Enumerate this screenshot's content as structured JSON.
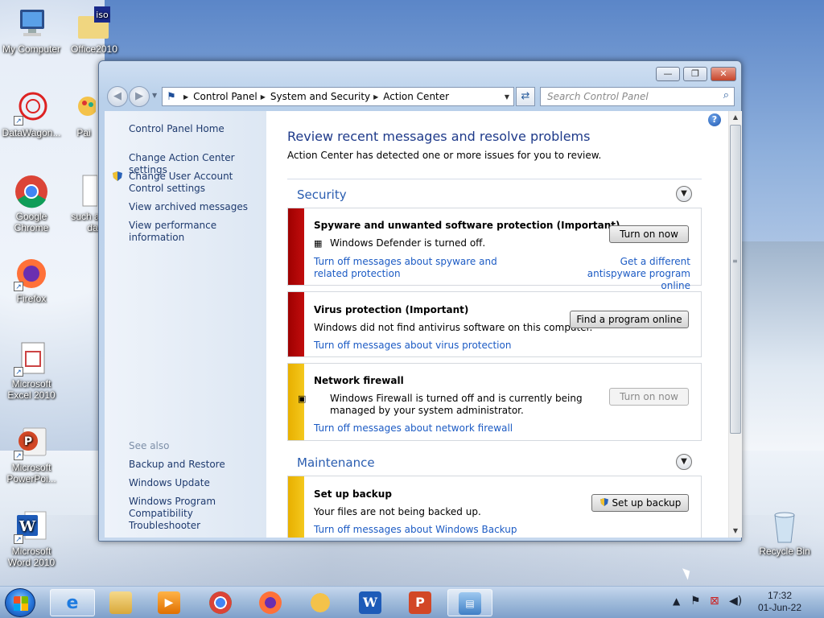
{
  "desktop": {
    "icons": [
      {
        "label": "My Computer",
        "icon": "computer-icon"
      },
      {
        "label": "Office2010",
        "icon": "iso-folder-icon",
        "badge": "iso"
      },
      {
        "label": "DataWagon...",
        "icon": "datawagon-icon"
      },
      {
        "label": "Pai",
        "icon": "paint-icon"
      },
      {
        "label": "Google Chrome",
        "icon": "chrome-icon"
      },
      {
        "label": "such a",
        "label2": "da",
        "icon": "document-icon"
      },
      {
        "label": "Firefox",
        "icon": "firefox-icon"
      },
      {
        "label": "Microsoft Excel 2010",
        "icon": "excel-icon"
      },
      {
        "label": "Microsoft PowerPoi...",
        "icon": "powerpoint-icon"
      },
      {
        "label": "Microsoft Word 2010",
        "icon": "word-icon"
      },
      {
        "label": "Recycle Bin",
        "icon": "recycle-bin-icon"
      }
    ]
  },
  "window": {
    "controls": {
      "minimize": "—",
      "maximize": "❐",
      "close": "✕"
    },
    "address": {
      "crumbs": [
        "Control Panel",
        "System and Security",
        "Action Center"
      ]
    },
    "search": {
      "placeholder": "Search Control Panel"
    },
    "sidebar": {
      "home": "Control Panel Home",
      "links": [
        "Change Action Center settings",
        "Change User Account Control settings",
        "View archived messages",
        "View performance information"
      ],
      "see_also_title": "See also",
      "see_also": [
        "Backup and Restore",
        "Windows Update",
        "Windows Program Compatibility Troubleshooter"
      ]
    },
    "main": {
      "heading": "Review recent messages and resolve problems",
      "subtitle": "Action Center has detected one or more issues for you to review.",
      "sections": {
        "security": "Security",
        "maintenance": "Maintenance"
      },
      "cards": {
        "spyware": {
          "title": "Spyware and unwanted software protection  (Important)",
          "text": "Windows Defender is turned off.",
          "link_left": "Turn off messages about spyware and related protection",
          "link_right": "Get a different antispyware program online",
          "button": "Turn on now",
          "severity_color": "#b30000"
        },
        "virus": {
          "title": "Virus protection  (Important)",
          "text": "Windows did not find antivirus software on this computer.",
          "link": "Turn off messages about virus protection",
          "button": "Find a program online",
          "severity_color": "#b30000"
        },
        "firewall": {
          "title": "Network firewall",
          "text": "Windows Firewall is turned off and is currently being managed by your system administrator.",
          "link": "Turn off messages about network firewall",
          "button": "Turn on now",
          "severity_color": "#f0be0f"
        },
        "backup": {
          "title": "Set up backup",
          "text": "Your files are not being backed up.",
          "link": "Turn off messages about Windows Backup",
          "button": "Set up backup",
          "severity_color": "#f0be0f"
        }
      }
    }
  },
  "taskbar": {
    "apps": [
      "Internet Explorer",
      "Windows Explorer",
      "Windows Media Player",
      "Google Chrome",
      "Firefox",
      "Paint",
      "Word",
      "PowerPoint",
      "Action Center"
    ],
    "clock": {
      "time": "17:32",
      "date": "01-Jun-22"
    }
  },
  "colors": {
    "link": "#1c5bc4",
    "heading": "#1e3a8a",
    "critical": "#b30000",
    "warning": "#f0be0f"
  }
}
